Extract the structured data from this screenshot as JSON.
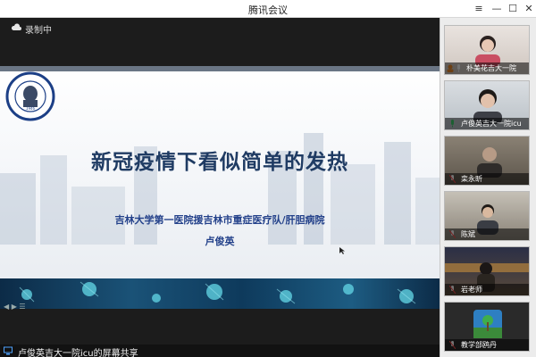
{
  "window": {
    "title": "腾讯会议"
  },
  "recording": {
    "label": "录制中",
    "icon": "cloud-icon"
  },
  "slide": {
    "title": "新冠疫情下看似简单的发热",
    "subtitle": "吉林大学第一医院援吉林市重症医疗队/肝胆病院",
    "author": "卢俊英",
    "colors": {
      "title": "#1f3b63",
      "subtitle": "#23418a"
    }
  },
  "share_status": {
    "text": "卢俊英吉大一院icu的屏幕共享",
    "icon": "screen-share-icon"
  },
  "participants": [
    {
      "name": "朴美花吉大一院",
      "badge": "host-icon",
      "mic": "mic-icon"
    },
    {
      "name": "卢俊英吉大一院icu",
      "badge": "",
      "mic": "mic-icon"
    },
    {
      "name": "栾永昕",
      "badge": "",
      "mic": "mic-muted-icon"
    },
    {
      "name": "陈斌",
      "badge": "",
      "mic": "mic-muted-icon"
    },
    {
      "name": "岩老师",
      "badge": "",
      "mic": "mic-muted-icon"
    },
    {
      "name": "教学部鸥丹",
      "badge": "",
      "mic": "mic-muted-icon"
    }
  ]
}
